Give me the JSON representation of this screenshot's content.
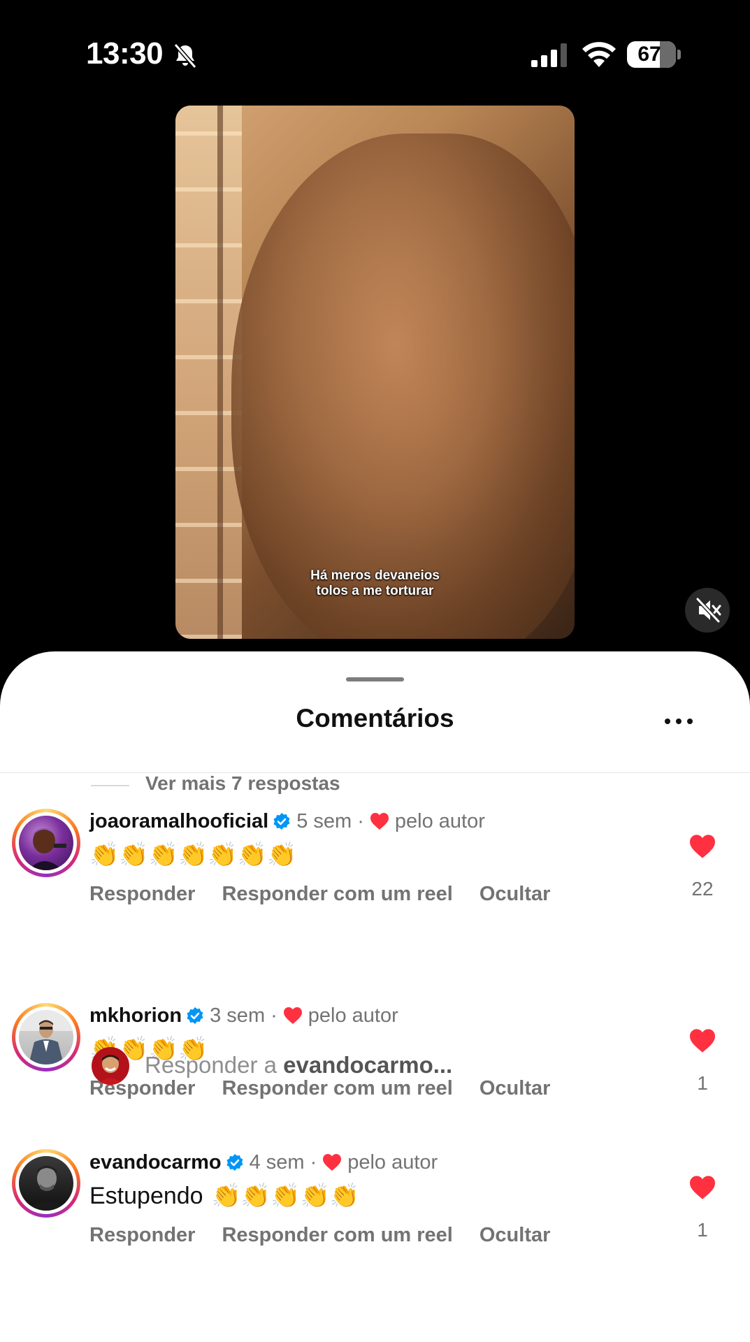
{
  "status_bar": {
    "time": "13:30",
    "battery": "67",
    "battery_level": 0.67
  },
  "video": {
    "caption_line1": "Há meros devaneios",
    "caption_line2": "tolos a me torturar"
  },
  "sheet": {
    "title": "Comentários"
  },
  "comments": [
    {
      "username": "joaoramalhooficial",
      "age": "5 sem",
      "separator": "·",
      "by_author": "pelo autor",
      "text": "",
      "claps": 7,
      "actions": [
        "Responder",
        "Responder com um reel",
        "Ocultar"
      ],
      "likes": "22"
    },
    {
      "username": "mkhorion",
      "age": "3 sem",
      "separator": "·",
      "by_author": "pelo autor",
      "text": "",
      "claps": 4,
      "actions": [
        "Responder",
        "Responder com um reel",
        "Ocultar"
      ],
      "likes": "1"
    },
    {
      "username": "evandocarmo",
      "age": "4 sem",
      "separator": "·",
      "by_author": "pelo autor",
      "text": "Estupendo",
      "claps": 5,
      "actions": [
        "Responder",
        "Responder com um reel",
        "Ocultar"
      ],
      "likes": "1"
    }
  ],
  "view_more": "Ver mais 7 respostas",
  "reply_bar": {
    "prefix": "Responder a ",
    "target": "evandocarmo..."
  },
  "colors": {
    "heart": "#ff3040",
    "verified": "#0095f6",
    "muted_text": "#737373"
  },
  "icons": [
    "bell-slash-icon",
    "signal-icon",
    "wifi-icon",
    "battery-icon",
    "mute-icon",
    "more-icon",
    "verified-icon",
    "heart-icon",
    "clap-emoji"
  ]
}
